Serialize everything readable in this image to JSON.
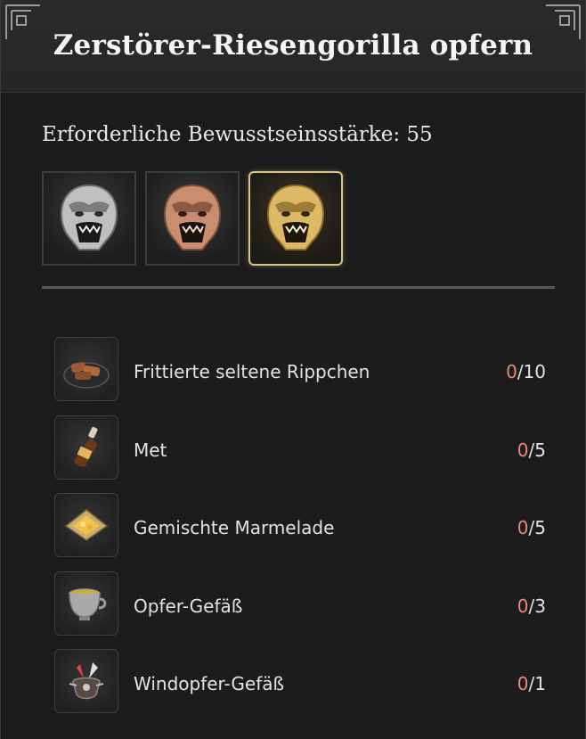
{
  "header": {
    "title": "Zerstörer-Riesengorilla opfern"
  },
  "requirement": {
    "text": "Erforderliche Bewusstseinsstärke: 55"
  },
  "tiers": [
    {
      "name": "silver-gorilla",
      "color": "#c9c9c9",
      "shade": "#7d7d7d",
      "selected": false
    },
    {
      "name": "bronze-gorilla",
      "color": "#d49b7e",
      "shade": "#8a5a44",
      "selected": false
    },
    {
      "name": "gold-gorilla",
      "color": "#e6c57c",
      "shade": "#9c7b34",
      "selected": true
    }
  ],
  "items": [
    {
      "name": "Frittierte seltene Rippchen",
      "have": "0",
      "need": "/10",
      "icon": "ribs-icon"
    },
    {
      "name": "Met",
      "have": "0",
      "need": "/5",
      "icon": "mead-bottle-icon"
    },
    {
      "name": "Gemischte Marmelade",
      "have": "0",
      "need": "/5",
      "icon": "marmalade-icon"
    },
    {
      "name": "Opfer-Gefäß",
      "have": "0",
      "need": "/3",
      "icon": "offering-cup-icon"
    },
    {
      "name": "Windopfer-Gefäß",
      "have": "0",
      "need": "/1",
      "icon": "wind-vessel-icon"
    }
  ],
  "colors": {
    "missing_count": "#e8897a",
    "selected_border": "#d9c48a"
  }
}
